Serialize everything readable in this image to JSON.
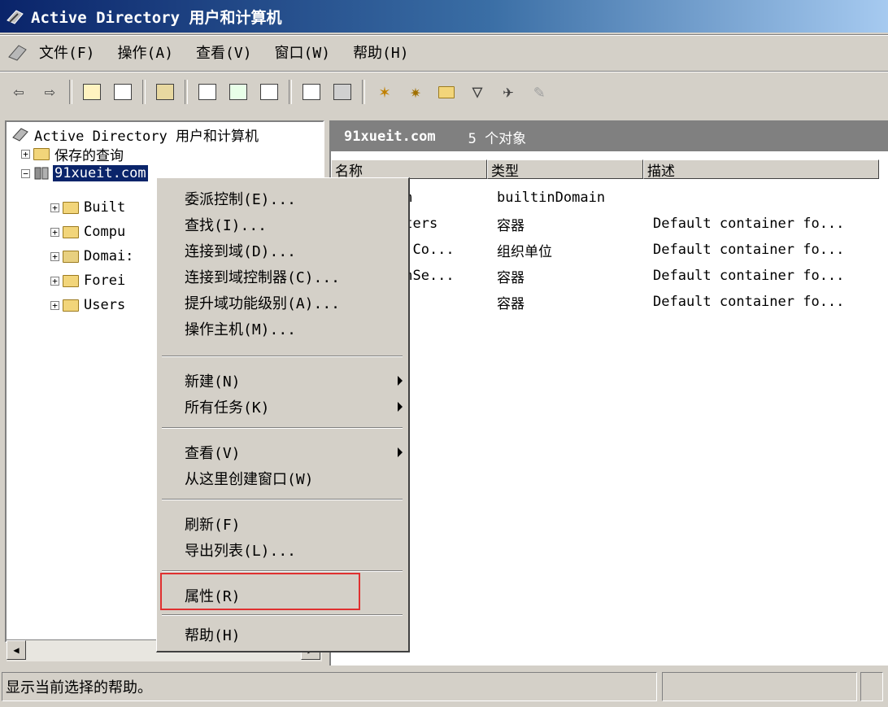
{
  "window": {
    "title": "Active Directory 用户和计算机",
    "icon": "aduc-icon"
  },
  "menubar": [
    "文件(F)",
    "操作(A)",
    "查看(V)",
    "窗口(W)",
    "帮助(H)"
  ],
  "tree": {
    "root": "Active Directory 用户和计算机",
    "saved_queries": "保存的查询",
    "domain": "91xueit.com",
    "children": [
      "Built",
      "Compu",
      "Domai:",
      "Forei",
      "Users"
    ]
  },
  "rightpane": {
    "domain": "91xueit.com",
    "count": "5 个对象",
    "columns": [
      "名称",
      "类型",
      "描述"
    ],
    "rows": [
      {
        "name": "in",
        "type": "builtinDomain",
        "desc": ""
      },
      {
        "name": "uters",
        "type": "容器",
        "desc": "Default container fo..."
      },
      {
        "name": "n Co...",
        "type": "组织单位",
        "desc": "Default container fo..."
      },
      {
        "name": "gnSe...",
        "type": "容器",
        "desc": "Default container fo..."
      },
      {
        "name": "s",
        "type": "容器",
        "desc": "Default container fo..."
      }
    ]
  },
  "context_menu": {
    "group1": [
      "委派控制(E)...",
      "查找(I)...",
      "连接到域(D)...",
      "连接到域控制器(C)...",
      "提升域功能级别(A)...",
      "操作主机(M)..."
    ],
    "group2": [
      "新建(N)",
      "所有任务(K)"
    ],
    "group3": [
      "查看(V)",
      "从这里创建窗口(W)"
    ],
    "group4": [
      "刷新(F)",
      "导出列表(L)..."
    ],
    "group5": [
      "属性(R)"
    ],
    "group6": [
      "帮助(H)"
    ]
  },
  "statusbar": {
    "text": "显示当前选择的帮助。"
  },
  "colors": {
    "title_start": "#0a246a",
    "title_end": "#a6caf0",
    "selection": "#0a246a",
    "highlight_box": "#e03030"
  }
}
